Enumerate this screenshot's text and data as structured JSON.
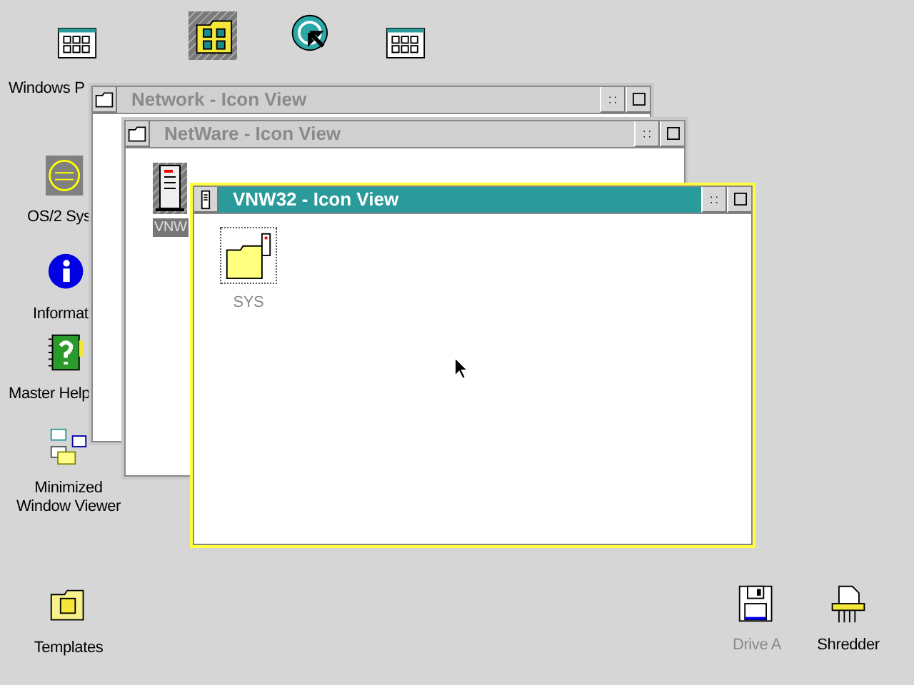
{
  "desktop_icons": [
    {
      "kind": "grid-window",
      "label": "Windows P",
      "selected": false,
      "disabled": false
    },
    {
      "kind": "network-folder",
      "selected": true
    },
    {
      "kind": "start-here",
      "selected": false
    },
    {
      "kind": "grid-window",
      "selected": false
    },
    {
      "kind": "os2",
      "label": "OS/2 Sys",
      "selected": false,
      "disabled": false
    },
    {
      "kind": "info",
      "label": "Informat",
      "selected": false,
      "disabled": false
    },
    {
      "kind": "help-book",
      "label": "Master Help",
      "selected": false,
      "disabled": false
    },
    {
      "kind": "mini-viewer",
      "label": "Minimized Window Viewer",
      "selected": false,
      "disabled": false
    },
    {
      "kind": "templates",
      "label": "Templates",
      "selected": false,
      "disabled": false
    },
    {
      "kind": "floppy",
      "label": "Drive A",
      "selected": false,
      "disabled": true
    },
    {
      "kind": "shredder",
      "label": "Shredder",
      "selected": false,
      "disabled": false
    }
  ],
  "windows": [
    {
      "title": "Network - Icon View",
      "active": false,
      "kind": "folder"
    },
    {
      "title": "NetWare - Icon View",
      "active": false,
      "kind": "folder",
      "icons": [
        {
          "kind": "server",
          "label": "VNW",
          "selected": true,
          "disabled": false,
          "focused": false
        }
      ]
    },
    {
      "title": "VNW32 - Icon View",
      "active": true,
      "kind": "server",
      "icons": [
        {
          "kind": "server-folder",
          "label": "SYS",
          "selected": false,
          "disabled": true,
          "focused": true
        }
      ]
    }
  ]
}
